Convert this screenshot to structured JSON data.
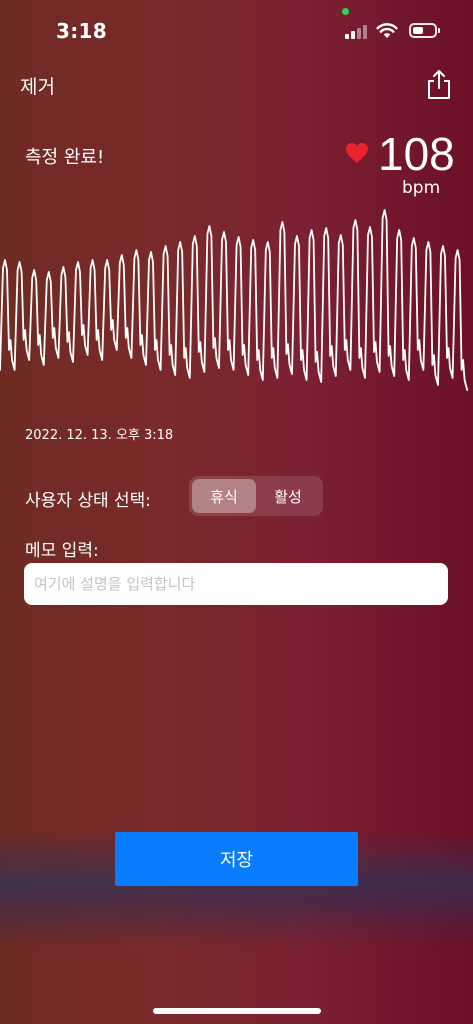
{
  "status_bar": {
    "time": "3:18",
    "icons": [
      "camera-in-use-dot",
      "cellular-signal-icon",
      "wifi-icon",
      "battery-icon"
    ]
  },
  "header": {
    "remove_label": "제거",
    "share_icon": "share-icon"
  },
  "measurement": {
    "status_text": "측정 완료!",
    "heart_icon": "heart-icon",
    "heart_color": "#e8242d",
    "bpm_value": "108",
    "bpm_unit": "bpm",
    "timestamp": "2022. 12. 13. 오후 3:18"
  },
  "user_state": {
    "label": "사용자 상태 선택:",
    "options": [
      "휴식",
      "활성"
    ],
    "selected": "휴식"
  },
  "memo": {
    "label": "메모 입력:",
    "value": "",
    "placeholder": "여기에 설명을 입력합니다"
  },
  "actions": {
    "save_label": "저장",
    "save_color": "#0a7cff"
  }
}
